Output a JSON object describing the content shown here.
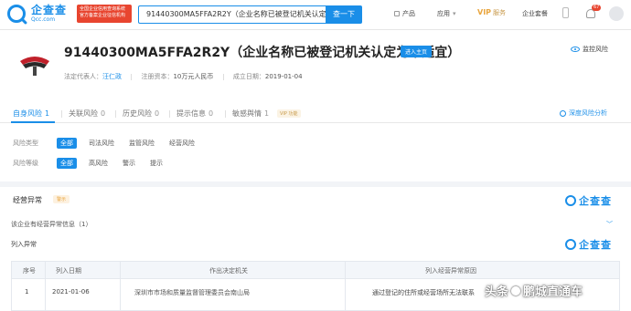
{
  "topbar": {
    "logo_cn": "企查查",
    "logo_en": "Qcc.com",
    "badge_text": "全国企业信用查询系统 官方备案企业征信机构",
    "search_value": "91440300MA5FFA2R2Y（企业名称已被登记机关认定",
    "search_button": "查一下",
    "nav_products": "产品",
    "nav_apps": "应用",
    "nav_vip": "VIP",
    "nav_vip_sub": "服务",
    "nav_enterprise": "企业套餐",
    "bell_count": "67"
  },
  "company": {
    "title": "91440300MA5FFA2R2Y（企业名称已被登记机关认定为不适宜）",
    "enter_button": "进入主页",
    "follow_label": "监控风险",
    "legal_rep_label": "法定代表人：",
    "legal_rep_value": "汪仁政",
    "capital_label": "注册资本：",
    "capital_value": "10万元人民币",
    "founded_label": "成立日期：",
    "founded_value": "2019-01-04"
  },
  "tabs": [
    {
      "label": "自身风险",
      "count": "1"
    },
    {
      "label": "关联风险",
      "count": "0"
    },
    {
      "label": "历史风险",
      "count": "0"
    },
    {
      "label": "提示信息",
      "count": "0"
    },
    {
      "label": "敏感舆情",
      "count": "1"
    }
  ],
  "vip_tag": "VIP 功能",
  "deep_risk": "深度风险分析",
  "filters": {
    "type_label": "风险类型",
    "type_options": [
      "全部",
      "司法风险",
      "监管风险",
      "经营风险"
    ],
    "level_label": "风险等级",
    "level_options": [
      "全部",
      "高风险",
      "警示",
      "提示"
    ]
  },
  "section": {
    "title": "经营异常",
    "tag": "警示",
    "watermark": "企查查",
    "info_row": "该企业有经营异常信息（1）",
    "list_label": "列入异常"
  },
  "table": {
    "headers": [
      "序号",
      "列入日期",
      "作出决定机关",
      "列入经营异常原因"
    ],
    "rows": [
      [
        "1",
        "2021-01-06",
        "深圳市市场和质量监督管理委员会南山局",
        "通过登记的住所或经营场所无法联系"
      ]
    ]
  },
  "overlay": {
    "prefix": "头条",
    "name": "鹏城直通车"
  },
  "colors": {
    "accent": "#1a8ee8",
    "danger": "#e8452f",
    "vip": "#e9a53d"
  }
}
